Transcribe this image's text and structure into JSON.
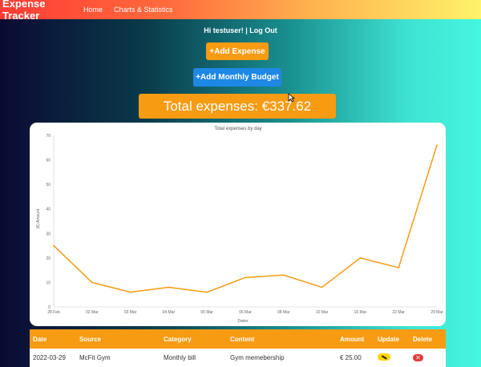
{
  "nav": {
    "brand": "Expense Tracker",
    "links": [
      "Home",
      "Charts & Statistics"
    ]
  },
  "user": {
    "greeting": "Hi testuser! | ",
    "logout": "Log Out"
  },
  "buttons": {
    "add_expense": "+Add Expense",
    "add_budget": "+Add Monthly Budget"
  },
  "total": {
    "label": "Total expenses: €337.62"
  },
  "chart_data": {
    "type": "line",
    "title": "Total expenses by day",
    "xlabel": "Dates",
    "ylabel": "(€) Amount",
    "ylim": [
      0,
      70
    ],
    "yticks": [
      0,
      10,
      20,
      30,
      40,
      50,
      60,
      70
    ],
    "x": [
      "28 Feb",
      "02 Mar",
      "03 Mar",
      "04 Mar",
      "05 Mar",
      "06 Mar",
      "08 Mar",
      "10 Mar",
      "15 Mar",
      "22 Mar",
      "29 Mar"
    ],
    "values": [
      25,
      10,
      6,
      8,
      6,
      12,
      13,
      8,
      20,
      16,
      66
    ],
    "line_color": "#f79b12",
    "grid": false
  },
  "table": {
    "headers": [
      "Date",
      "Source",
      "Category",
      "Content",
      "Amount",
      "Update",
      "Delete"
    ],
    "rows": [
      {
        "date": "2022-03-29",
        "source": "McFit Gym",
        "category": "Monthly bill",
        "content": "Gym memebership",
        "amount": "€ 25.00"
      }
    ]
  },
  "colors": {
    "accent_orange": "#f79b12",
    "accent_blue": "#1e88e5",
    "update_yellow": "#ffd600",
    "delete_red": "#e53935"
  }
}
